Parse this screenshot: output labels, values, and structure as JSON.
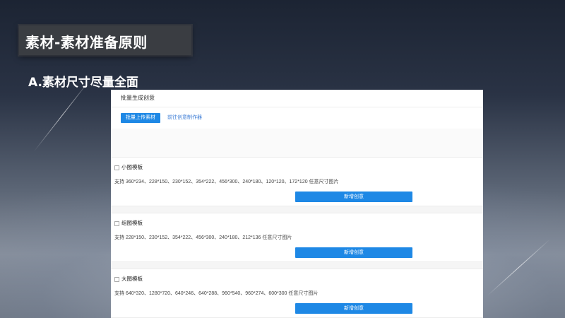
{
  "slide": {
    "title": "素材-素材准备原则",
    "subtitle": "A.素材尺寸尽量全面"
  },
  "panel": {
    "header": "批量生成创意",
    "upload_button": "批量上传素材",
    "maker_link": "前往创意制作器",
    "add_button_label": "新增创意",
    "sections": [
      {
        "title": "小图模板",
        "desc": "支持 360*234、228*150、230*152、354*222、456*300、240*180、120*120、172*120 任意尺寸图片"
      },
      {
        "title": "组图模板",
        "desc": "支持 228*150、230*152、354*222、456*300、240*180、212*136 任意尺寸图片"
      },
      {
        "title": "大图模板",
        "desc": "支持 640*320、1280*720、640*246、640*288、960*540、960*274、600*300 任意尺寸图片"
      }
    ]
  },
  "colors": {
    "accent": "#1e88e5",
    "title_box": "#3a3d42"
  }
}
